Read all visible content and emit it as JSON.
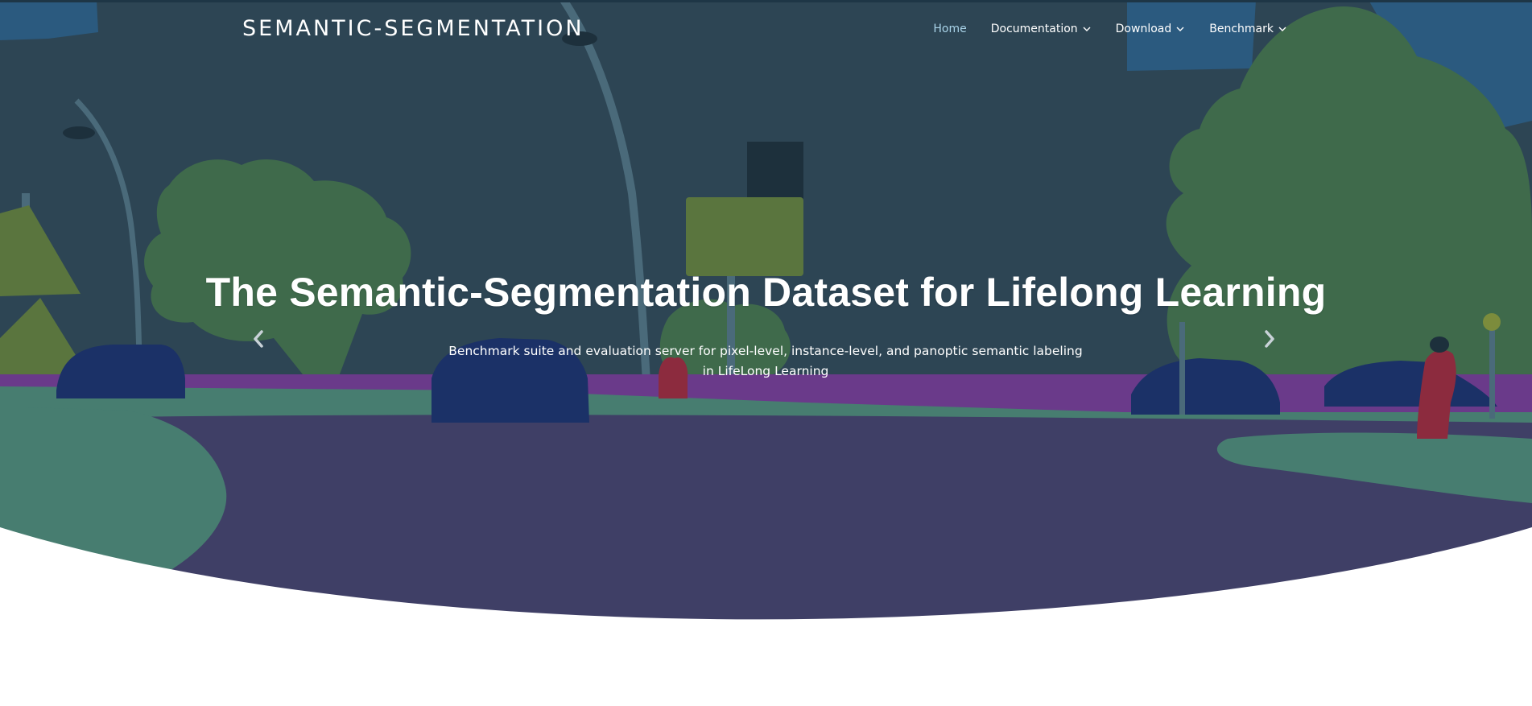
{
  "header": {
    "brand": "SEMANTIC-SEGMENTATION",
    "nav": [
      {
        "label": "Home",
        "active": true,
        "has_dropdown": false
      },
      {
        "label": "Documentation",
        "active": false,
        "has_dropdown": true
      },
      {
        "label": "Download",
        "active": false,
        "has_dropdown": true
      },
      {
        "label": "Benchmark",
        "active": false,
        "has_dropdown": true
      }
    ]
  },
  "hero": {
    "title": "The Semantic-Segmentation Dataset for Lifelong Learning",
    "subtitle": "Benchmark suite and evaluation server for pixel-level, instance-level, and panoptic semantic labeling in LifeLong Learning",
    "prev_icon": "chevron-left-icon",
    "next_icon": "chevron-right-icon"
  },
  "colors": {
    "sky": "#2d4554",
    "vegetation": "#3f6a4b",
    "road": "#3f3f66",
    "sidewalk": "#6a3a8a",
    "terrain": "#477d70",
    "car": "#1b3167",
    "sign": "#5a753e",
    "person": "#8c2b3e",
    "building_blue": "#2b5a7f",
    "swoosh": "#d3e3ec",
    "nav_active": "#a9d3e8"
  }
}
